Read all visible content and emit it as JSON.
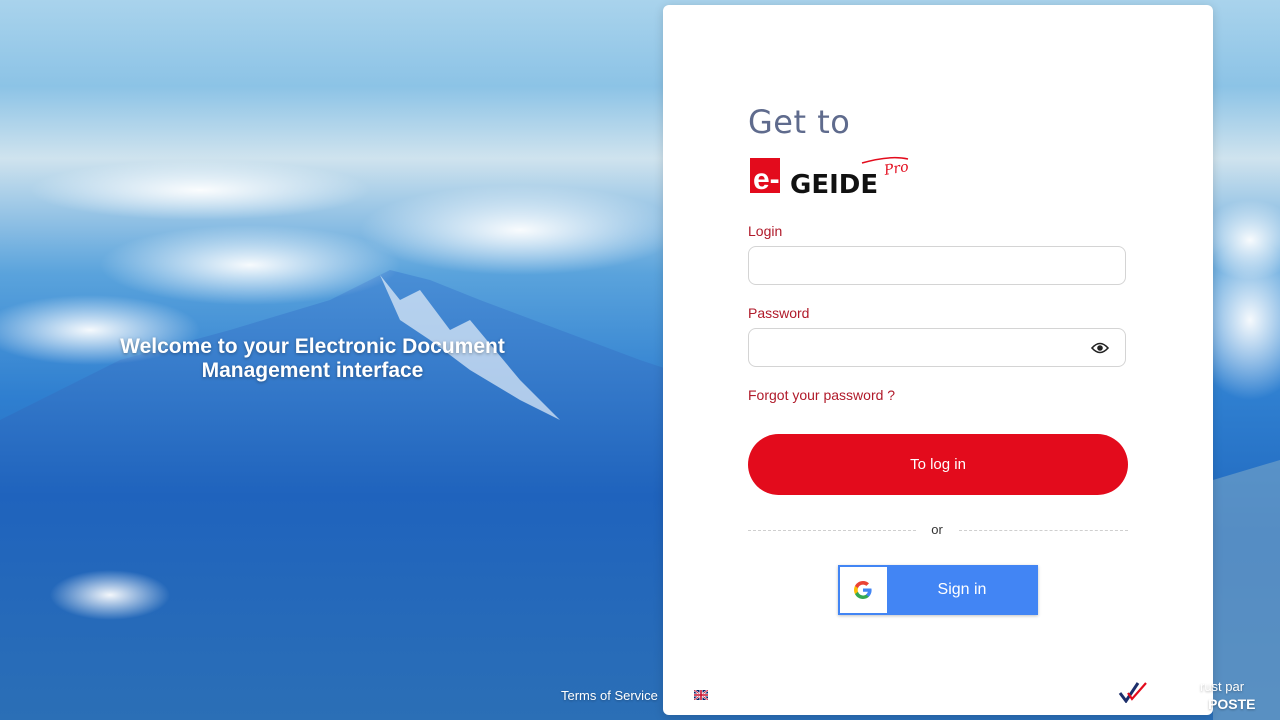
{
  "welcome": {
    "line1": "Welcome to your Electronic Document",
    "line2": "Management interface"
  },
  "panel": {
    "heading": "Get to",
    "logo": {
      "brand_e": "e-",
      "brand_name": "GEIDE",
      "brand_suffix": "Pro",
      "brand_color": "#e30b1c"
    },
    "login": {
      "label": "Login",
      "value": "",
      "placeholder": ""
    },
    "password": {
      "label": "Password",
      "value": "",
      "placeholder": "",
      "toggle_icon": "eye-icon"
    },
    "forgot_link": "Forgot your password ?",
    "submit_label": "To log in",
    "divider_text": "or",
    "google": {
      "icon": "google-icon",
      "label": "Sign in",
      "color": "#4285f4"
    },
    "language_flag": "uk-flag-icon"
  },
  "footer": {
    "terms": "Terms of Service",
    "trust_line1": "rust par",
    "trust_line2": "POSTE"
  },
  "colors": {
    "accent": "#e30b1c",
    "label": "#b01a2a",
    "heading": "#5f6b8d"
  }
}
